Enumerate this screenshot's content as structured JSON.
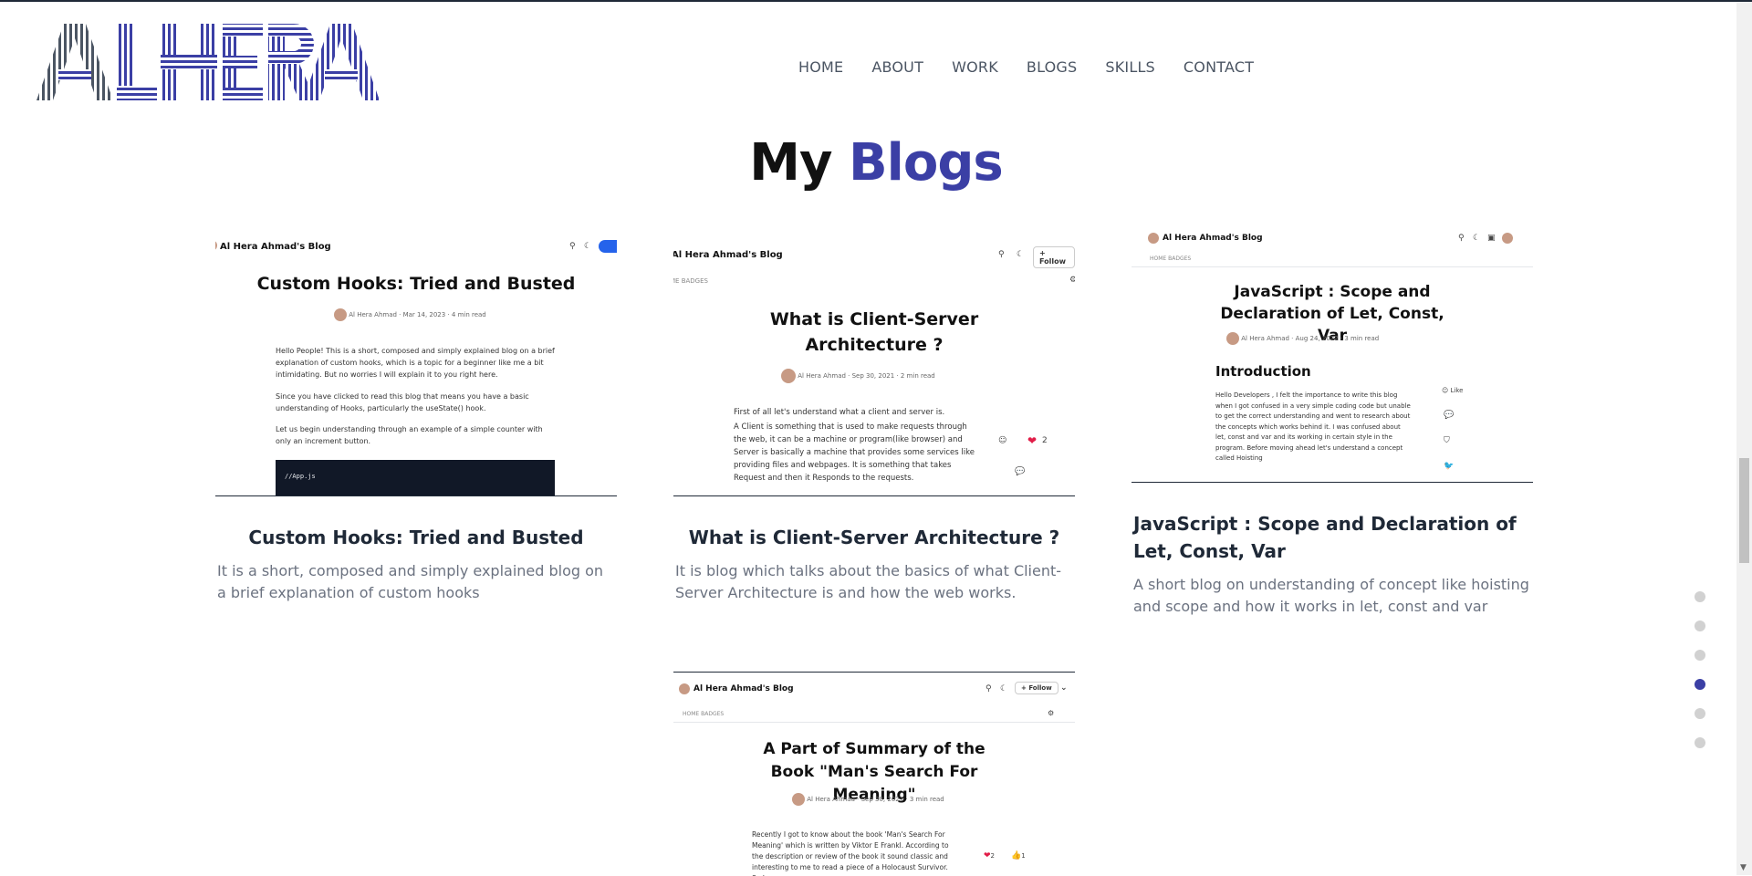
{
  "logo": {
    "text": "ALHERA"
  },
  "nav": [
    "HOME",
    "ABOUT",
    "WORK",
    "BLOGS",
    "SKILLS",
    "CONTACT"
  ],
  "section": {
    "title_main": "My",
    "title_accent": "Blogs"
  },
  "colors": {
    "accent": "#3b3fa5",
    "dot_active": "#3b3fa5",
    "dot_inactive": "#d1d1d1"
  },
  "cards": [
    {
      "title": "Custom Hooks: Tried and Busted",
      "description": "It is a short, composed and simply explained blog on a brief explanation of custom hooks",
      "shot": {
        "blog_name": "Al Hera Ahmad's Blog",
        "post_title": "Custom Hooks: Tried and Busted",
        "meta": "Al Hera Ahmad · Mar 14, 2023 · 4 min read",
        "paragraphs": [
          "Hello People! This is a short, composed and simply explained blog on a brief explanation of custom hooks, which is a topic for a beginner like me a bit intimidating. But no worries I will explain it to you right here.",
          "Since you have clicked to read this blog that means you have a basic understanding of Hooks, particularly the useState() hook.",
          "Let us begin understanding through an example of a simple counter with only an increment button."
        ],
        "code": "//App.js"
      }
    },
    {
      "title": "What is Client-Server Architecture ?",
      "description": "It is blog which talks about the basics of what Client-Server Architecture is and how the web works.",
      "shot": {
        "blog_name": "Al Hera Ahmad's Blog",
        "follow": "Follow",
        "tabs": "ME   BADGES",
        "post_title": "What is Client-Server Architecture ?",
        "meta": "Al Hera Ahmad · Sep 30, 2021 · 2 min read",
        "paragraphs": [
          "First of all let's understand what a client and server is.",
          "A Client is something that is used to make requests through the web, it can be a machine or program(like browser) and Server is basically a machine that provides some services like providing files and webpages. It is something that takes Request and then it Responds to the requests."
        ],
        "likes": "2"
      }
    },
    {
      "title": "JavaScript : Scope and Declaration of Let, Const, Var",
      "description": "A short blog on understanding of concept like hoisting and scope and how it works in let, const and var",
      "shot": {
        "blog_name": "Al Hera Ahmad's Blog",
        "tabs": "HOME   BADGES",
        "post_title": "JavaScript : Scope and Declaration of Let, Const, Var",
        "meta": "Al Hera Ahmad · Aug 24, 2022 · 3 min read",
        "heading": "Introduction",
        "paragraphs": [
          "Hello Developers , I felt the importance to write this blog when I got confused in a very simple coding code but unable to get the correct understanding and went to research about the concepts which works behind it. I was confused about let, const and var and its working in certain style in the program. Before moving ahead let's understand a concept called Hoisting"
        ],
        "like_label": "Like"
      }
    },
    {
      "title": "",
      "description": "",
      "shot": {
        "blog_name": "Al Hera Ahmad's Blog",
        "follow": "Follow",
        "tabs": "HOME   BADGES",
        "post_title": "A Part of Summary of the Book \"Man's Search For Meaning\"",
        "meta": "Al Hera Ahmad · Sep 30, 2021 · 3 min read",
        "paragraphs": [
          "Recently I got to know about the book 'Man's Search For Meaning' which is written by Viktor E Frankl. According to the description or review of the book it sound classic and interesting to me to read a piece of a Holocaust Survivor. So I"
        ],
        "likes": "2",
        "claps": "1"
      }
    }
  ],
  "dot_nav": {
    "count": 6,
    "active_index": 3
  }
}
